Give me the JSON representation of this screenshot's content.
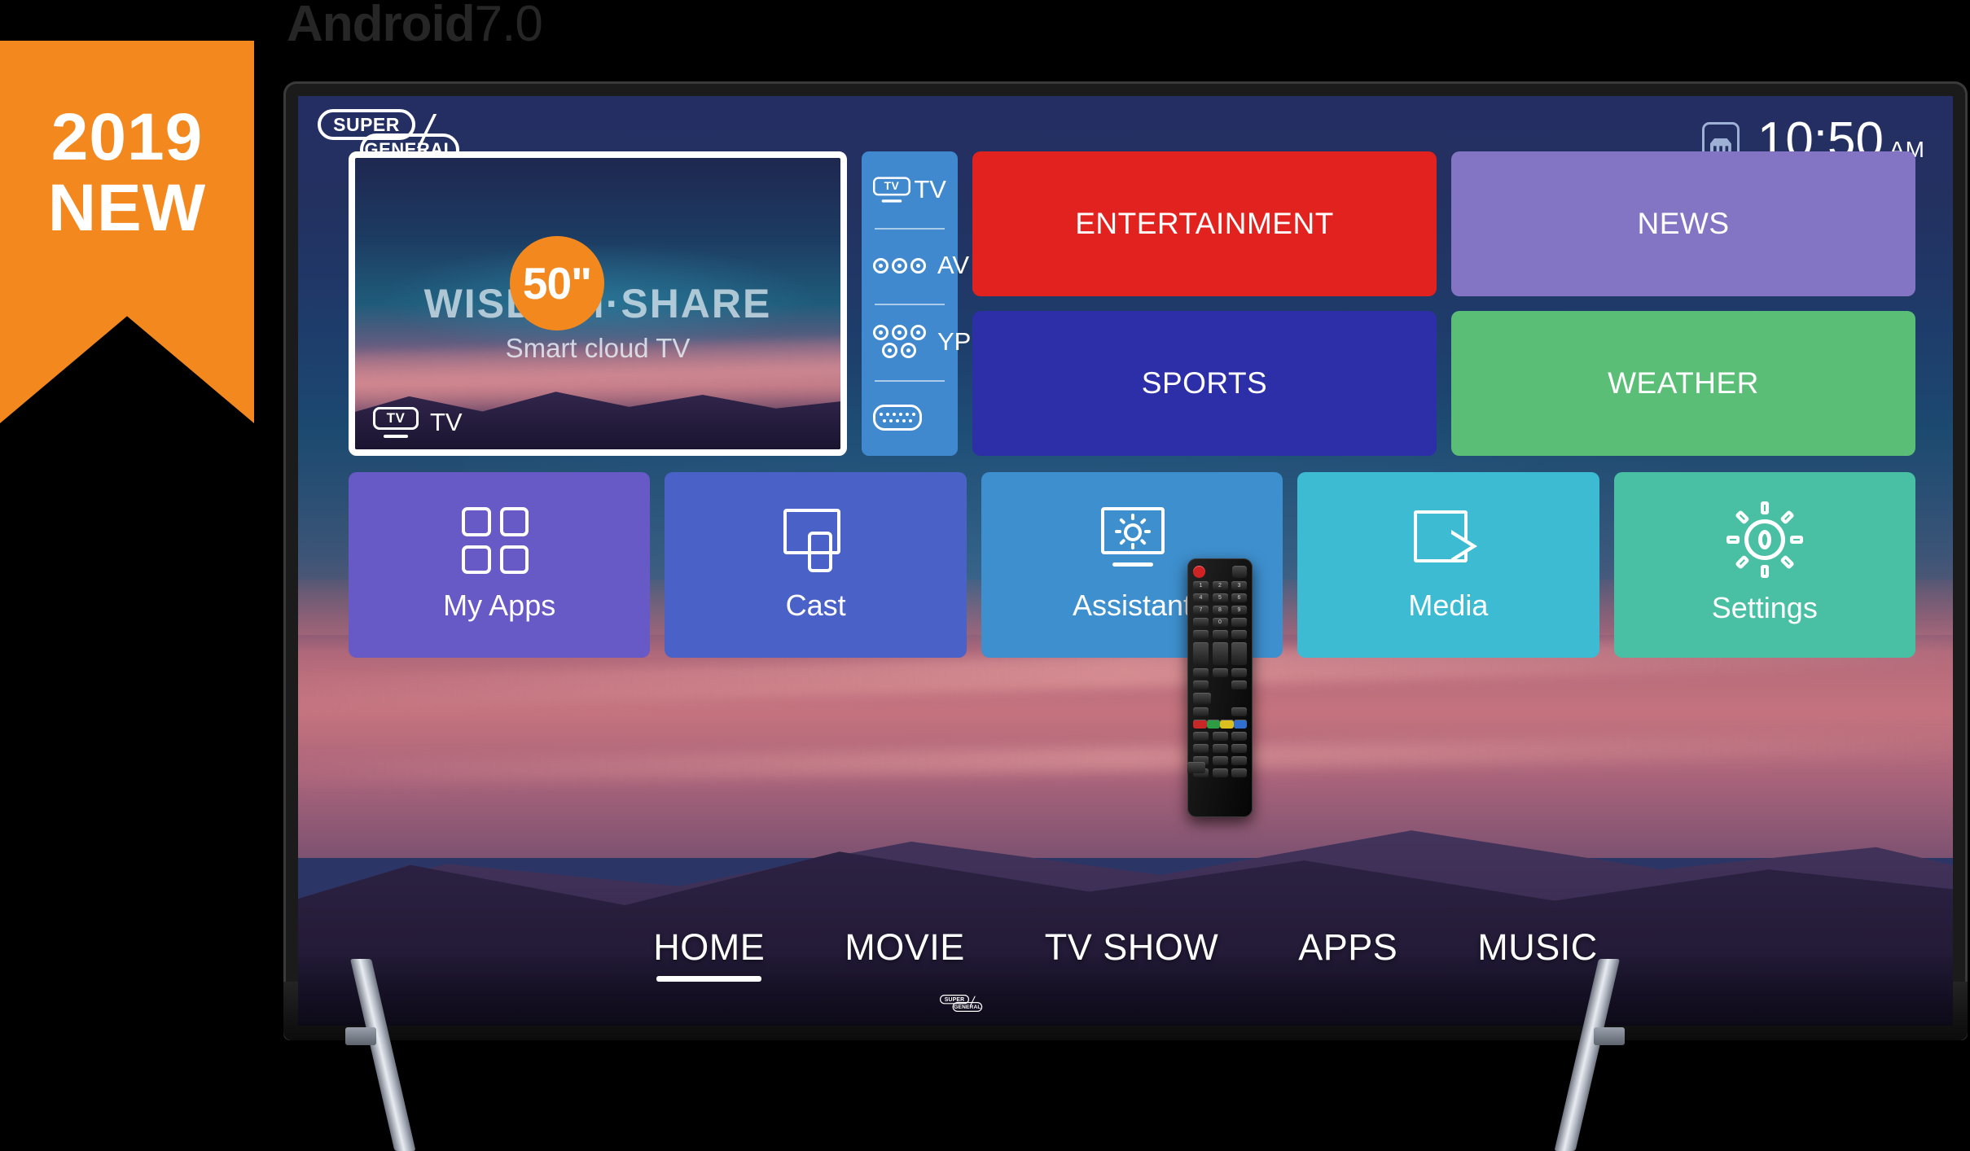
{
  "caption": {
    "bold": "Android",
    "light": "7.0"
  },
  "ribbon": {
    "line1": "2019",
    "line2": "NEW",
    "color": "#F2881E"
  },
  "brand": {
    "top": "SUPER",
    "bottom": "GENERAL"
  },
  "size_badge": {
    "text": "50\""
  },
  "status_bar": {
    "lan_icon": "ethernet-icon",
    "time": "10:50",
    "meridiem": "AM"
  },
  "preview": {
    "title": "WISDOM·SHARE",
    "subtitle": "Smart cloud TV",
    "badge_icon": "tv-icon",
    "badge_label": "TV"
  },
  "sources": [
    {
      "label": "TV",
      "icon": "tv-icon"
    },
    {
      "label": "AV",
      "icon": "rca-3-icon"
    },
    {
      "label": "YPBPR",
      "icon": "rca-5-icon"
    },
    {
      "label": "",
      "icon": "vga-port-icon"
    }
  ],
  "categories": [
    {
      "label": "ENTERTAINMENT",
      "color": "#E2221F"
    },
    {
      "label": "NEWS",
      "color": "#8375C3"
    },
    {
      "label": "SPORTS",
      "color": "#2C2FA8"
    },
    {
      "label": "WEATHER",
      "color": "#5BBE77"
    }
  ],
  "apps": [
    {
      "label": "My Apps",
      "icon": "grid-apps-icon",
      "color": "#6759C6"
    },
    {
      "label": "Cast",
      "icon": "cast-icon",
      "color": "#4A62C8"
    },
    {
      "label": "Assistant",
      "icon": "assistant-icon",
      "color": "#3E8FCE"
    },
    {
      "label": "Media",
      "icon": "media-play-icon",
      "color": "#3CBBD3"
    },
    {
      "label": "Settings",
      "icon": "gear-icon",
      "color": "#49BFA4"
    }
  ],
  "nav": [
    {
      "label": "HOME",
      "active": true
    },
    {
      "label": "MOVIE",
      "active": false
    },
    {
      "label": "TV SHOW",
      "active": false
    },
    {
      "label": "APPS",
      "active": false
    },
    {
      "label": "MUSIC",
      "active": false
    }
  ],
  "remote": {
    "power_key": "power-button",
    "mute_key": "mute-button",
    "numeric_keys": [
      "1",
      "2",
      "3",
      "4",
      "5",
      "6",
      "7",
      "8",
      "9",
      "0"
    ],
    "color_keys": [
      "red",
      "green",
      "yellow",
      "blue"
    ]
  }
}
